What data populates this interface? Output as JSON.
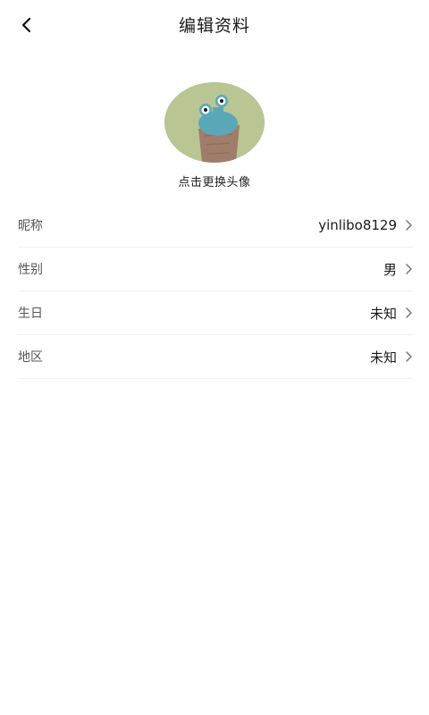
{
  "header": {
    "title": "编辑资料",
    "back_icon": "chevron-left-icon"
  },
  "avatar": {
    "caption": "点击更换头像",
    "image": "snail-avatar"
  },
  "profile": {
    "rows": [
      {
        "label": "昵称",
        "value": "yinlibo8129",
        "icon": "chevron-right-icon"
      },
      {
        "label": "性别",
        "value": "男",
        "icon": "chevron-right-icon"
      },
      {
        "label": "生日",
        "value": "未知",
        "icon": "chevron-right-icon"
      },
      {
        "label": "地区",
        "value": "未知",
        "icon": "chevron-right-icon"
      }
    ]
  },
  "colors": {
    "background": "#ffffff",
    "divider": "#f0f0f0",
    "label": "#555555",
    "value": "#1a1a1a",
    "avatar_bg": "#b9c694"
  }
}
